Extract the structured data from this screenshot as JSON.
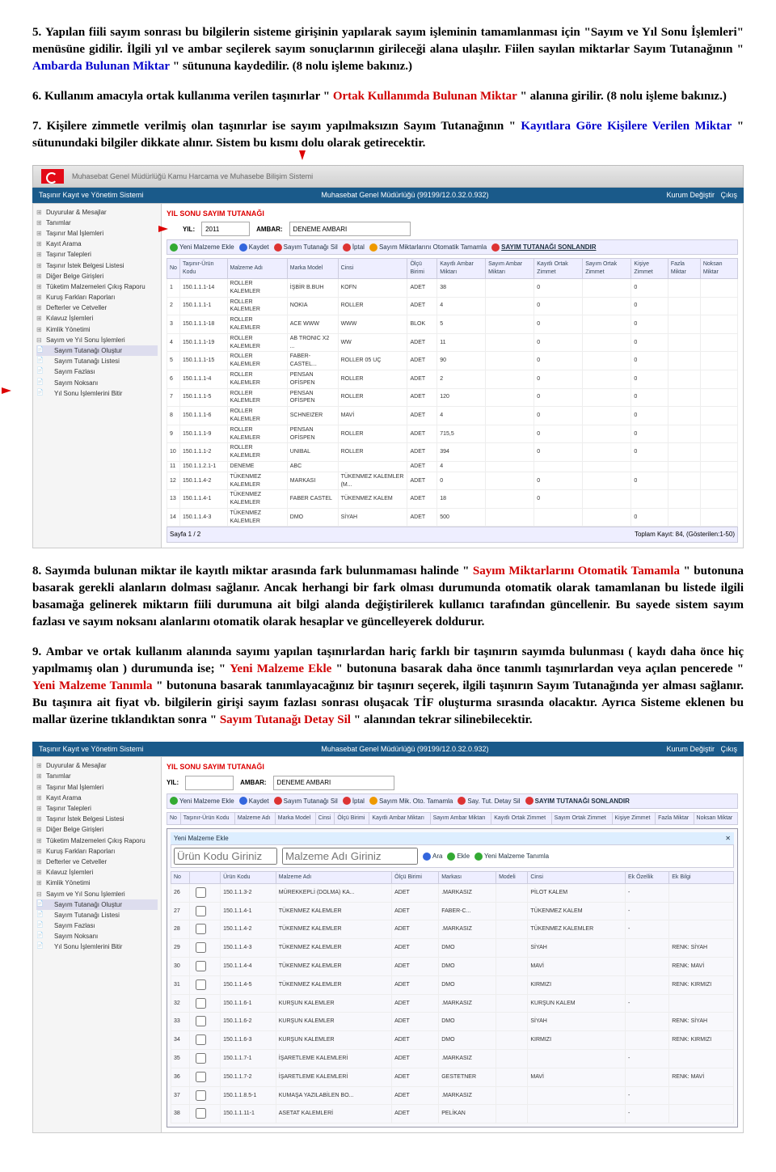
{
  "para5": {
    "num": "5.",
    "text_a": "Yapılan fiili sayım sonrası bu bilgilerin sisteme girişinin yapılarak sayım işleminin tamamlanması için \"Sayım ve Yıl Sonu İşlemleri\" menüsüne gidilir. İlgili yıl ve ambar seçilerek sayım sonuçlarının girileceği alana ulaşılır. Fiilen sayılan miktarlar Sayım Tutanağının \"",
    "blue": "Ambarda Bulunan Miktar",
    "text_b": "\" sütununa kaydedilir. (8 nolu işleme bakınız.)"
  },
  "para6": {
    "num": "6.",
    "text_a": "Kullanım amacıyla ortak kullanıma verilen taşınırlar \"",
    "red": "Ortak Kullanımda Bulunan Miktar",
    "text_b": "\" alanına girilir. (8 nolu işleme bakınız.)"
  },
  "para7": {
    "num": "7.",
    "text_a": "Kişilere zimmetle verilmiş olan taşınırlar ise sayım yapılmaksızın Sayım Tutanağının \"",
    "blue": "Kayıtlara Göre Kişilere Verilen Miktar",
    "text_b": "\" sütunundaki bilgiler dikkate alınır. Sistem bu kısmı dolu olarak getirecektir."
  },
  "para8": {
    "num": "8.",
    "text_a": "Sayımda bulunan miktar ile kayıtlı miktar arasında fark bulunmaması halinde \"",
    "red": "Sayım Miktarlarını Otomatik Tamamla",
    "text_b": "\" butonuna basarak gerekli alanların dolması sağlanır. Ancak herhangi bir fark olması durumunda otomatik olarak tamamlanan bu listede ilgili basamağa gelinerek miktarın fiili durumuna ait bilgi alanda değiştirilerek kullanıcı tarafından güncellenir. Bu sayede sistem sayım fazlası ve sayım noksanı alanlarını otomatik olarak hesaplar ve güncelleyerek doldurur."
  },
  "para9": {
    "num": "9.",
    "text_a": "Ambar ve ortak kullanım alanında sayımı yapılan taşınırlardan hariç farklı bir taşınırın sayımda bulunması ( kaydı daha önce hiç yapılmamış olan ) durumunda ise; \"",
    "red1": "Yeni Malzeme Ekle",
    "text_b": "\" butonuna basarak daha önce tanımlı taşınırlardan veya açılan pencerede \"",
    "red2": "Yeni Malzeme Tanımla",
    "text_c": "\" butonuna basarak tanımlayacağınız bir taşınırı seçerek, ilgili taşınırın Sayım Tutanağında yer alması sağlanır. Bu taşınıra ait fiyat vb. bilgilerin girişi sayım fazlası sonrası oluşacak TİF oluşturma sırasında olacaktır. Ayrıca Sisteme eklenen bu mallar üzerine tıklandıktan sonra \"",
    "red3": "Sayım Tutanağı Detay Sil ",
    "text_d": "\" alanından tekrar silinebilecektir."
  },
  "shot1": {
    "header": "Muhasebat Genel Müdürlüğü Kamu Harcama ve Muhasebe Bilişim Sistemi",
    "sub_left": "Taşınır Kayıt ve Yönetim Sistemi",
    "sub_mid": "Muhasebat Genel Müdürlüğü (99199/12.0.32.0.932)",
    "sub_right_a": "Kurum Değiştir",
    "sub_right_b": "Çıkış",
    "panel_title": "YIL SONU SAYIM TUTANAĞI",
    "yil_label": "YIL:",
    "yil_value": "2011",
    "ambar_label": "AMBAR:",
    "ambar_value": "DENEME AMBARI",
    "btn_yeni": "Yeni Malzeme Ekle",
    "btn_kaydet": "Kaydet",
    "btn_tutanak_sil": "Sayım Tutanağı Sil",
    "btn_iptal": "İptal",
    "btn_otomatik": "Sayım Miktarlarını Otomatik Tamamla",
    "btn_sonlandir": "SAYIM TUTANAĞI SONLANDIR",
    "sidebar": [
      "Duyurular & Mesajlar",
      "Tanımlar",
      "Taşınır Mal İşlemleri",
      "Kayıt Arama",
      "Taşınır Talepleri",
      "Taşınır İstek Belgesi Listesi",
      "Diğer Belge Girişleri",
      "Tüketim Malzemeleri Çıkış Raporu",
      "Kuruş Farkları Raporları",
      "Defterler ve Cetveller",
      "Kılavuz İşlemleri",
      "Kimlik Yönetimi",
      "Sayım ve Yıl Sonu İşlemleri",
      "Sayım Tutanağı Oluştur",
      "Sayım Tutanağı Listesi",
      "Sayım Fazlası",
      "Sayım Noksanı",
      "Yıl Sonu İşlemlerini Bitir"
    ],
    "cols": [
      "No",
      "Taşınır-Ürün Kodu",
      "Malzeme Adı",
      "Marka Model",
      "Cinsi",
      "Ölçü Birimi",
      "Kayıtlı Ambar Miktarı",
      "Sayım Ambar Miktarı",
      "Kayıtlı Ortak Zimmet",
      "Sayım Ortak Zimmet",
      "Kişiye Zimmet",
      "Fazla Miktar",
      "Noksan Miktar"
    ],
    "rows": [
      [
        "1",
        "150.1.1.1-14",
        "ROLLER KALEMLER",
        "İŞBİR B.BUH",
        "KOFN",
        "ADET",
        "38",
        "",
        "0",
        "",
        "0",
        "",
        ""
      ],
      [
        "2",
        "150.1.1.1-1",
        "ROLLER KALEMLER",
        "NOKIA",
        "ROLLER",
        "ADET",
        "4",
        "",
        "0",
        "",
        "0",
        "",
        ""
      ],
      [
        "3",
        "150.1.1.1-18",
        "ROLLER KALEMLER",
        "ACE WWW",
        "WWW",
        "BLOK",
        "5",
        "",
        "0",
        "",
        "0",
        "",
        ""
      ],
      [
        "4",
        "150.1.1.1-19",
        "ROLLER KALEMLER",
        "AB TRONIC X2 ...",
        "WW",
        "ADET",
        "11",
        "",
        "0",
        "",
        "0",
        "",
        ""
      ],
      [
        "5",
        "150.1.1.1-15",
        "ROLLER KALEMLER",
        "FABER-CASTEL...",
        "ROLLER 05 UÇ",
        "ADET",
        "90",
        "",
        "0",
        "",
        "0",
        "",
        ""
      ],
      [
        "6",
        "150.1.1.1-4",
        "ROLLER KALEMLER",
        "PENSAN OFİSPEN",
        "ROLLER",
        "ADET",
        "2",
        "",
        "0",
        "",
        "0",
        "",
        ""
      ],
      [
        "7",
        "150.1.1.1-5",
        "ROLLER KALEMLER",
        "PENSAN OFİSPEN",
        "ROLLER",
        "ADET",
        "120",
        "",
        "0",
        "",
        "0",
        "",
        ""
      ],
      [
        "8",
        "150.1.1.1-6",
        "ROLLER KALEMLER",
        "SCHNEIZER",
        "MAVİ",
        "ADET",
        "4",
        "",
        "0",
        "",
        "0",
        "",
        ""
      ],
      [
        "9",
        "150.1.1.1-9",
        "ROLLER KALEMLER",
        "PENSAN OFİSPEN",
        "ROLLER",
        "ADET",
        "715,5",
        "",
        "0",
        "",
        "0",
        "",
        ""
      ],
      [
        "10",
        "150.1.1.1-2",
        "ROLLER KALEMLER",
        "UNIBAL",
        "ROLLER",
        "ADET",
        "394",
        "",
        "0",
        "",
        "0",
        "",
        ""
      ],
      [
        "11",
        "150.1.1.2.1-1",
        "DENEME",
        "ABC",
        "",
        "ADET",
        "4",
        "",
        "",
        "",
        "",
        "",
        ""
      ],
      [
        "12",
        "150.1.1.4-2",
        "TÜKENMEZ KALEMLER",
        "MARKASI",
        "TÜKENMEZ KALEMLER (M...",
        "ADET",
        "0",
        "",
        "0",
        "",
        "0",
        "",
        ""
      ],
      [
        "13",
        "150.1.1.4-1",
        "TÜKENMEZ KALEMLER",
        "FABER CASTEL",
        "TÜKENMEZ KALEM",
        "ADET",
        "18",
        "",
        "0",
        "",
        "",
        "",
        ""
      ],
      [
        "14",
        "150.1.1.4-3",
        "TÜKENMEZ KALEMLER",
        "DMO",
        "SİYAH",
        "ADET",
        "500",
        "",
        "",
        "",
        "0",
        "",
        ""
      ]
    ],
    "pager_page": "Sayfa 1 / 2",
    "pager_total": "Toplam Kayıt: 84, (Gösterilen:1-50)"
  },
  "shot2": {
    "btn_detay_sil": "Say. Tut. Detay Sil",
    "btn_sonlandir2": "SAYIM TUTANAĞI SONLANDIR",
    "btn_mik_oto": "Sayım Mik. Oto. Tamamla",
    "modal_title": "Yeni Malzeme Ekle",
    "urun_kodu_ph": "Ürün Kodu Giriniz",
    "malzeme_adi_ph": "Malzeme Adı Giriniz",
    "btn_ara": "Ara",
    "btn_ekle": "Ekle",
    "btn_yeni_tanimla": "Yeni Malzeme Tanımla",
    "mcols": [
      "No",
      "",
      "Ürün Kodu",
      "Malzeme Adı",
      "Ölçü Birimi",
      "Markası",
      "Modeli",
      "Cinsi",
      "Ek Özellik",
      "Ek Bilgi"
    ],
    "mrows": [
      [
        "26",
        "",
        "150.1.1.3-2",
        "MÜREKKEPLİ (DOLMA) KA...",
        "ADET",
        ".MARKASIZ",
        "",
        "PİLOT KALEM",
        "-",
        ""
      ],
      [
        "27",
        "",
        "150.1.1.4-1",
        "TÜKENMEZ KALEMLER",
        "ADET",
        "FABER-C...",
        "",
        "TÜKENMEZ KALEM",
        "-",
        ""
      ],
      [
        "28",
        "",
        "150.1.1.4-2",
        "TÜKENMEZ KALEMLER",
        "ADET",
        ".MARKASIZ",
        "",
        "TÜKENMEZ KALEMLER",
        "-",
        ""
      ],
      [
        "29",
        "",
        "150.1.1.4-3",
        "TÜKENMEZ KALEMLER",
        "ADET",
        "DMO",
        "",
        "SİYAH",
        "",
        "RENK: SİYAH"
      ],
      [
        "30",
        "",
        "150.1.1.4-4",
        "TÜKENMEZ KALEMLER",
        "ADET",
        "DMO",
        "",
        "MAVİ",
        "",
        "RENK: MAVİ"
      ],
      [
        "31",
        "",
        "150.1.1.4-5",
        "TÜKENMEZ KALEMLER",
        "ADET",
        "DMO",
        "",
        "KIRMIZI",
        "",
        "RENK: KIRMIZI"
      ],
      [
        "32",
        "",
        "150.1.1.6-1",
        "KURŞUN KALEMLER",
        "ADET",
        ".MARKASIZ",
        "",
        "KURŞUN KALEM",
        "-",
        ""
      ],
      [
        "33",
        "",
        "150.1.1.6-2",
        "KURŞUN KALEMLER",
        "ADET",
        "DMO",
        "",
        "SİYAH",
        "",
        "RENK: SİYAH"
      ],
      [
        "34",
        "",
        "150.1.1.6-3",
        "KURŞUN KALEMLER",
        "ADET",
        "DMO",
        "",
        "KIRMIZI",
        "",
        "RENK: KIRMIZI"
      ],
      [
        "35",
        "",
        "150.1.1.7-1",
        "İŞARETLEME KALEMLERİ",
        "ADET",
        ".MARKASIZ",
        "",
        "",
        "-",
        ""
      ],
      [
        "36",
        "",
        "150.1.1.7-2",
        "İŞARETLEME KALEMLERİ",
        "ADET",
        "GESTETNER",
        "",
        "MAVİ",
        "",
        "RENK: MAVİ"
      ],
      [
        "37",
        "",
        "150.1.1.8.5-1",
        "KUMAŞA YAZILABİLEN BO...",
        "ADET",
        ".MARKASIZ",
        "",
        "",
        "-",
        ""
      ],
      [
        "38",
        "",
        "150.1.1.11-1",
        "ASETAT KALEMLERİ",
        "ADET",
        "PELİKAN",
        "",
        "",
        "-",
        ""
      ]
    ]
  }
}
